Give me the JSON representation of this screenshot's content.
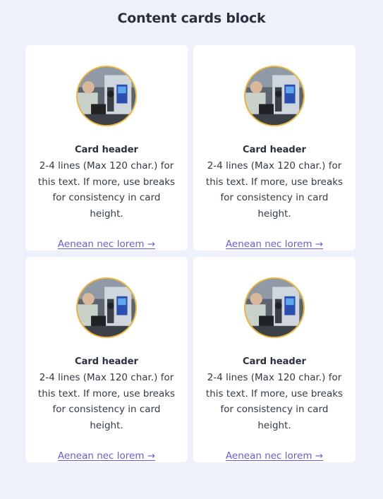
{
  "page": {
    "title": "Content cards block"
  },
  "cards": [
    {
      "header": "Card header",
      "body": "2-4 lines (Max 120 char.) for this text. If more, use breaks for consistency in card height.",
      "link": "Aenean nec lorem →"
    },
    {
      "header": "Card header",
      "body": "2-4 lines (Max 120 char.) for this text. If more, use breaks for consistency in card height.",
      "link": "Aenean nec lorem →"
    },
    {
      "header": "Card header",
      "body": "2-4 lines (Max 120 char.) for this text. If more, use breaks for consistency in card height.",
      "link": "Aenean nec lorem →"
    },
    {
      "header": "Card header",
      "body": "2-4 lines (Max 120 char.) for this text. If more, use breaks for consistency in card height.",
      "link": "Aenean nec lorem →"
    }
  ],
  "colors": {
    "background": "#eef0fb",
    "card": "#ffffff",
    "link": "#6a5ae0",
    "image_ring": "#f2b63a"
  }
}
